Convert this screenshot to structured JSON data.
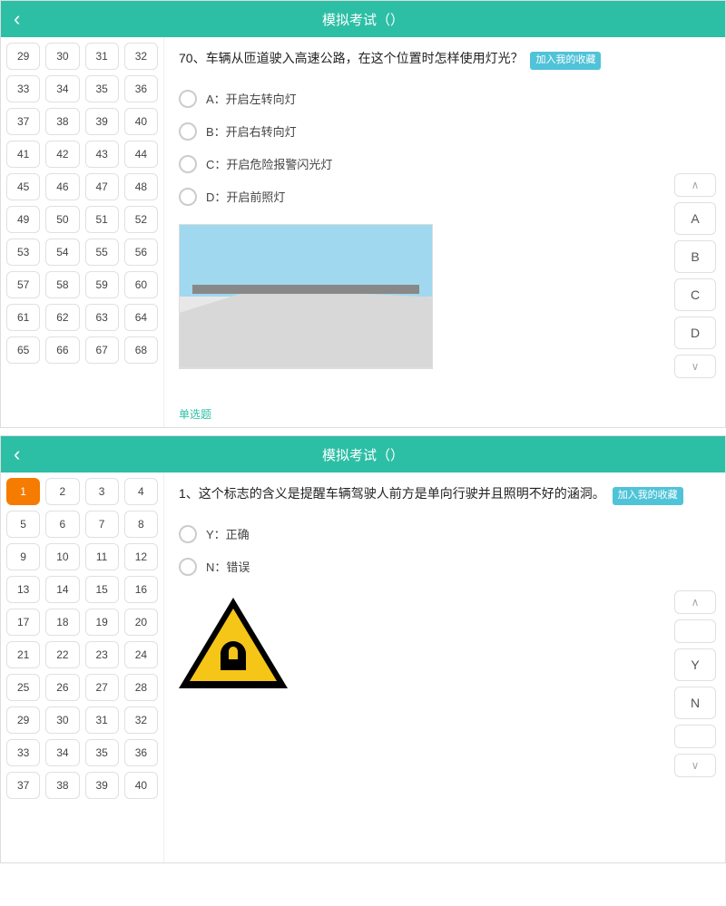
{
  "screen1": {
    "title": "模拟考试（）",
    "grid": [
      29,
      30,
      31,
      32,
      33,
      34,
      35,
      36,
      37,
      38,
      39,
      40,
      41,
      42,
      43,
      44,
      45,
      46,
      47,
      48,
      49,
      50,
      51,
      52,
      53,
      54,
      55,
      56,
      57,
      58,
      59,
      60,
      61,
      62,
      63,
      64,
      65,
      66,
      67,
      68
    ],
    "qnum": "70、",
    "qtext": "车辆从匝道驶入高速公路，在这个位置时怎样使用灯光？",
    "fav": "加入我的收藏",
    "options": [
      "A：开启左转向灯",
      "B：开启右转向灯",
      "C：开启危险报警闪光灯",
      "D：开启前照灯"
    ],
    "tag": "单选题",
    "answers": [
      "A",
      "B",
      "C",
      "D"
    ]
  },
  "screen2": {
    "title": "模拟考试（）",
    "grid": [
      1,
      2,
      3,
      4,
      5,
      6,
      7,
      8,
      9,
      10,
      11,
      12,
      13,
      14,
      15,
      16,
      17,
      18,
      19,
      20,
      21,
      22,
      23,
      24,
      25,
      26,
      27,
      28,
      29,
      30,
      31,
      32,
      33,
      34,
      35,
      36,
      37,
      38,
      39,
      40
    ],
    "active": 1,
    "qnum": "1、",
    "qtext": "这个标志的含义是提醒车辆驾驶人前方是单向行驶并且照明不好的涵洞。",
    "fav": "加入我的收藏",
    "options": [
      "Y：正确",
      "N：错误"
    ],
    "answers": [
      "Y",
      "N"
    ]
  },
  "nav": {
    "up": "∧",
    "down": "∨"
  }
}
